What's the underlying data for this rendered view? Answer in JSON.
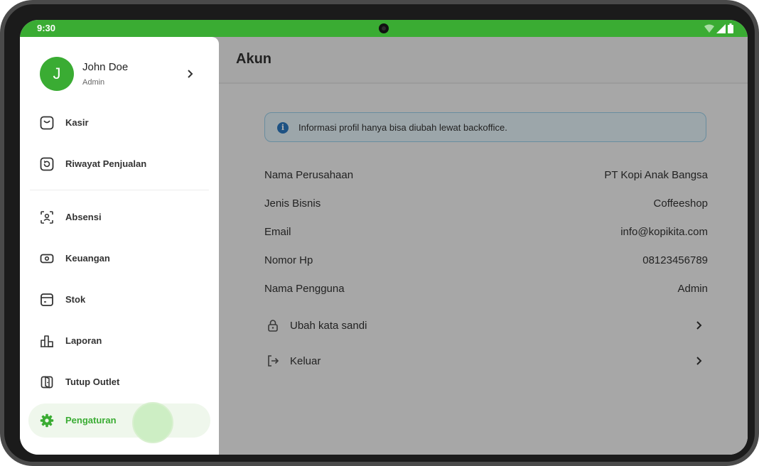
{
  "status_bar": {
    "time": "9:30"
  },
  "header": {
    "title": "Akun"
  },
  "banner": {
    "text": "Informasi profil hanya bisa diubah lewat backoffice.",
    "icon": "info-icon"
  },
  "profile_info": [
    {
      "label": "Nama Perusahaan",
      "value": "PT Kopi Anak Bangsa"
    },
    {
      "label": "Jenis Bisnis",
      "value": "Coffeeshop"
    },
    {
      "label": "Email",
      "value": "info@kopikita.com"
    },
    {
      "label": "Nomor Hp",
      "value": "08123456789"
    },
    {
      "label": "Nama Pengguna",
      "value": "Admin"
    }
  ],
  "actions": [
    {
      "label": "Ubah kata sandi",
      "icon": "lock-icon"
    },
    {
      "label": "Keluar",
      "icon": "logout-icon"
    }
  ],
  "drawer": {
    "user": {
      "initial": "J",
      "name": "John Doe",
      "role": "Admin"
    },
    "items": [
      {
        "label": "Kasir",
        "icon": "shopping-bag-icon"
      },
      {
        "label": "Riwayat Penjualan",
        "icon": "history-icon"
      },
      {
        "label": "Absensi",
        "icon": "face-scan-icon"
      },
      {
        "label": "Keuangan",
        "icon": "money-icon"
      },
      {
        "label": "Stok",
        "icon": "stock-icon"
      },
      {
        "label": "Laporan",
        "icon": "report-chart-icon"
      },
      {
        "label": "Tutup Outlet",
        "icon": "door-icon"
      },
      {
        "label": "Pengaturan",
        "icon": "gear-icon",
        "active": true
      }
    ]
  },
  "colors": {
    "brand": "#3aac33",
    "info": "#2b79c2",
    "banner_bg": "#e6f5fb",
    "banner_border": "#9bd0ea"
  }
}
